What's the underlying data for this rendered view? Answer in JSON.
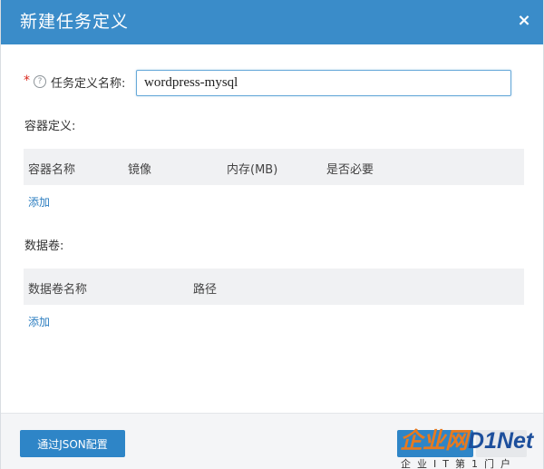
{
  "dialog": {
    "title": "新建任务定义",
    "close_glyph": "×"
  },
  "name_field": {
    "required_mark": "*",
    "help_glyph": "?",
    "label": "任务定义名称:",
    "value": "wordpress-mysql"
  },
  "containers": {
    "section_label": "容器定义:",
    "columns": [
      "容器名称",
      "镜像",
      "内存(MB)",
      "是否必要"
    ],
    "rows": [],
    "add_label": "添加"
  },
  "volumes": {
    "section_label": "数据卷:",
    "columns": [
      "数据卷名称",
      "路径"
    ],
    "rows": [],
    "add_label": "添加"
  },
  "footer": {
    "json_config_label": "通过JSON配置"
  },
  "watermark": {
    "brand_a": "企业网",
    "brand_b": "D1Net",
    "tagline": "企业IT第1门户"
  },
  "colors": {
    "header_bg": "#3a8cc9",
    "button_primary": "#2e85c7",
    "link": "#2e7fc1",
    "required": "#d9281c",
    "table_head_bg": "#f0f1f3"
  },
  "icons": {
    "close": "close-icon",
    "help": "help-circle-icon"
  }
}
